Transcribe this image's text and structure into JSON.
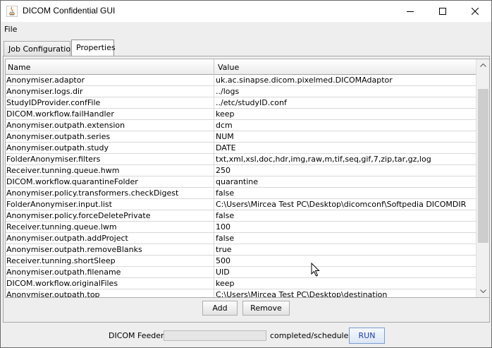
{
  "window": {
    "title": "DICOM Confidential GUI",
    "icon": "java-icon"
  },
  "menu": {
    "items": [
      {
        "label": "File"
      }
    ]
  },
  "tabs": [
    {
      "label": "Job Configuration",
      "selected": false
    },
    {
      "label": "Properties",
      "selected": true
    }
  ],
  "table": {
    "headers": {
      "name": "Name",
      "value": "Value"
    },
    "rows": [
      {
        "name": "Anonymiser.adaptor",
        "value": "uk.ac.sinapse.dicom.pixelmed.DICOMAdaptor"
      },
      {
        "name": "Anonymiser.logs.dir",
        "value": "../logs"
      },
      {
        "name": "StudyIDProvider.confFile",
        "value": "../etc/studyID.conf"
      },
      {
        "name": "DICOM.workflow.failHandler",
        "value": "keep"
      },
      {
        "name": "Anonymiser.outpath.extension",
        "value": "dcm"
      },
      {
        "name": "Anonymiser.outpath.series",
        "value": "NUM"
      },
      {
        "name": "Anonymiser.outpath.study",
        "value": "DATE"
      },
      {
        "name": "FolderAnonymiser.filters",
        "value": "txt,xml,xsl,doc,hdr,img,raw,m,tif,seq,gif,7,zip,tar,gz,log"
      },
      {
        "name": "Receiver.tunning.queue.hwm",
        "value": "250"
      },
      {
        "name": "DICOM.workflow.quarantineFolder",
        "value": "quarantine"
      },
      {
        "name": "Anonymiser.policy.transformers.checkDigest",
        "value": "false"
      },
      {
        "name": "FolderAnonymiser.input.list",
        "value": "C:\\Users\\Mircea Test PC\\Desktop\\dicomconf\\Softpedia DICOMDIR"
      },
      {
        "name": "Anonymiser.policy.forceDeletePrivate",
        "value": "false"
      },
      {
        "name": "Receiver.tunning.queue.lwm",
        "value": "100"
      },
      {
        "name": "Anonymiser.outpath.addProject",
        "value": "false"
      },
      {
        "name": "Anonymiser.outpath.removeBlanks",
        "value": "true"
      },
      {
        "name": "Receiver.tunning.shortSleep",
        "value": "500"
      },
      {
        "name": "Anonymiser.outpath.filename",
        "value": "UID"
      },
      {
        "name": "DICOM.workflow.originalFiles",
        "value": "keep"
      },
      {
        "name": "Anonymiser.outpath.top",
        "value": "C:\\Users\\Mircea Test PC\\Desktop\\destination"
      }
    ]
  },
  "buttons": {
    "add": "Add",
    "remove": "Remove",
    "run": "RUN"
  },
  "status": {
    "feeder_label": "DICOM Feeder",
    "completed_label": "completed/scheduled",
    "progress": 0
  },
  "colors": {
    "run_text": "#1a3da8",
    "selected_tab_bg": "#ffffff"
  }
}
